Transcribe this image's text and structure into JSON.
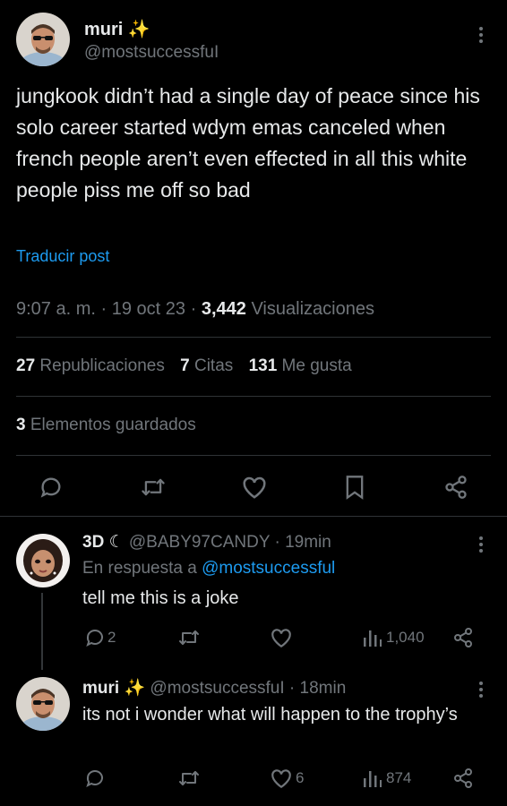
{
  "main_post": {
    "author_name": "muri",
    "author_emoji": "✨",
    "handle": "@mostsuccessfuI",
    "text": "jungkook didn’t had a single day of peace since his solo career started wdym emas canceled when french people aren’t even effected in all this white people piss me off so bad",
    "translate_label": "Traducir post",
    "time": "9:07 a. m.",
    "date": "19 oct 23",
    "views_count": "3,442",
    "views_label": "Visualizaciones",
    "reposts_count": "27",
    "reposts_label": "Republicaciones",
    "quotes_count": "7",
    "quotes_label": "Citas",
    "likes_count": "131",
    "likes_label": "Me gusta",
    "bookmarks_count": "3",
    "bookmarks_label": "Elementos guardados"
  },
  "replies": [
    {
      "author_name": "3D ☾",
      "handle": "@BABY97CANDY",
      "time": "19min",
      "reply_to_label": "En respuesta a",
      "reply_to_handle": "@mostsuccessful",
      "text": "tell me this is a joke",
      "reply_count": "2",
      "like_count": "",
      "views": "1,040"
    },
    {
      "author_name": "muri",
      "author_emoji": "✨",
      "handle": "@mostsuccessfuI",
      "time": "18min",
      "text": "its not i wonder what will happen to the trophy’s",
      "reply_count": "",
      "like_count": "6",
      "views": "874"
    }
  ],
  "separator": "·",
  "colors": {
    "background": "#000000",
    "text": "#e7e9ea",
    "muted": "#71767b",
    "link": "#1d9bf0",
    "border": "#2f3336"
  }
}
